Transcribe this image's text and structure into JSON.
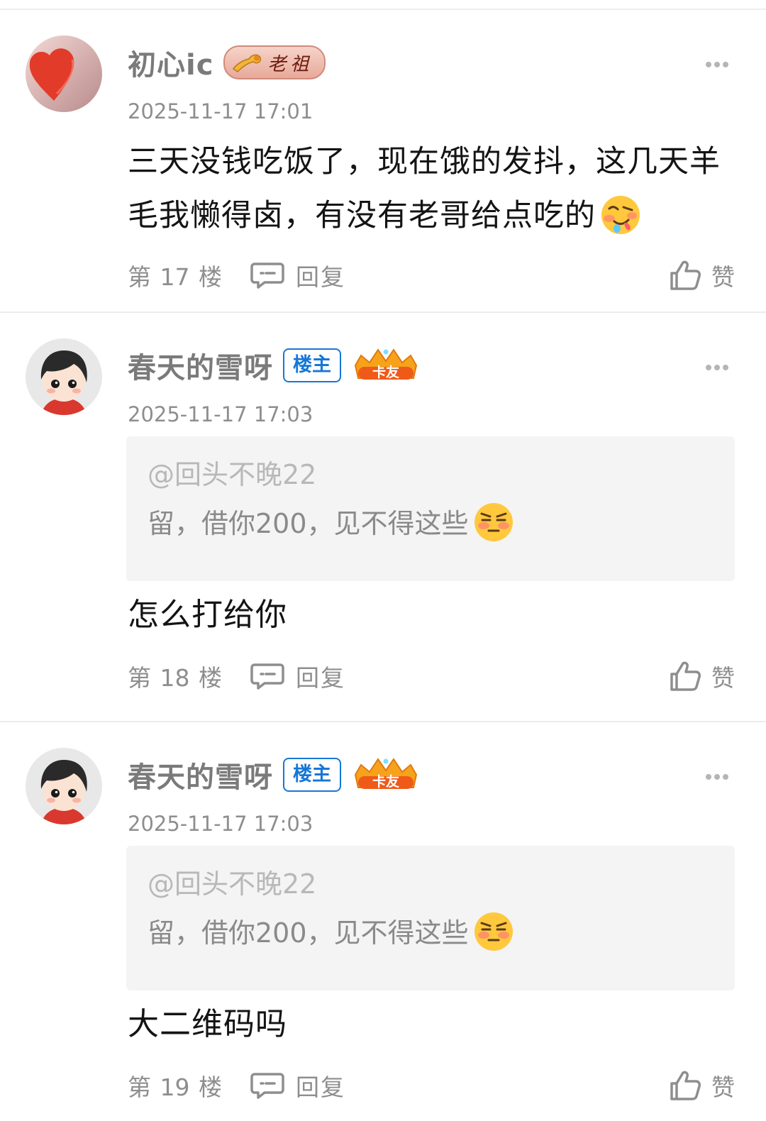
{
  "comments": [
    {
      "username": "初心ic",
      "title_badge": "老祖",
      "timestamp": "2025-11-17 17:01",
      "text": "三天没钱吃饭了，现在饿的发抖，这几天羊毛我懒得卤，有没有老哥给点吃的",
      "text_emoji": "drooling-face-emoji",
      "floor": "第 17 楼",
      "reply_label": "回复",
      "like_label": "赞"
    },
    {
      "username": "春天的雪呀",
      "op_badge": "楼主",
      "card_badge": "卡友",
      "timestamp": "2025-11-17 17:03",
      "quote": {
        "user": "@回头不晚22",
        "text": "留，借你200，见不得这些",
        "emoji": "annoyed-face-emoji"
      },
      "text": "怎么打给你",
      "floor": "第 18 楼",
      "reply_label": "回复",
      "like_label": "赞"
    },
    {
      "username": "春天的雪呀",
      "op_badge": "楼主",
      "card_badge": "卡友",
      "timestamp": "2025-11-17 17:03",
      "quote": {
        "user": "@回头不晚22",
        "text": "留，借你200，见不得这些",
        "emoji": "annoyed-face-emoji"
      },
      "text": "大二维码吗",
      "floor": "第 19 楼",
      "reply_label": "回复",
      "like_label": "赞"
    }
  ],
  "colors": {
    "op_badge_blue": "#1677d6",
    "muted_text": "#8e8e8e",
    "quote_bg": "#f4f4f4"
  }
}
